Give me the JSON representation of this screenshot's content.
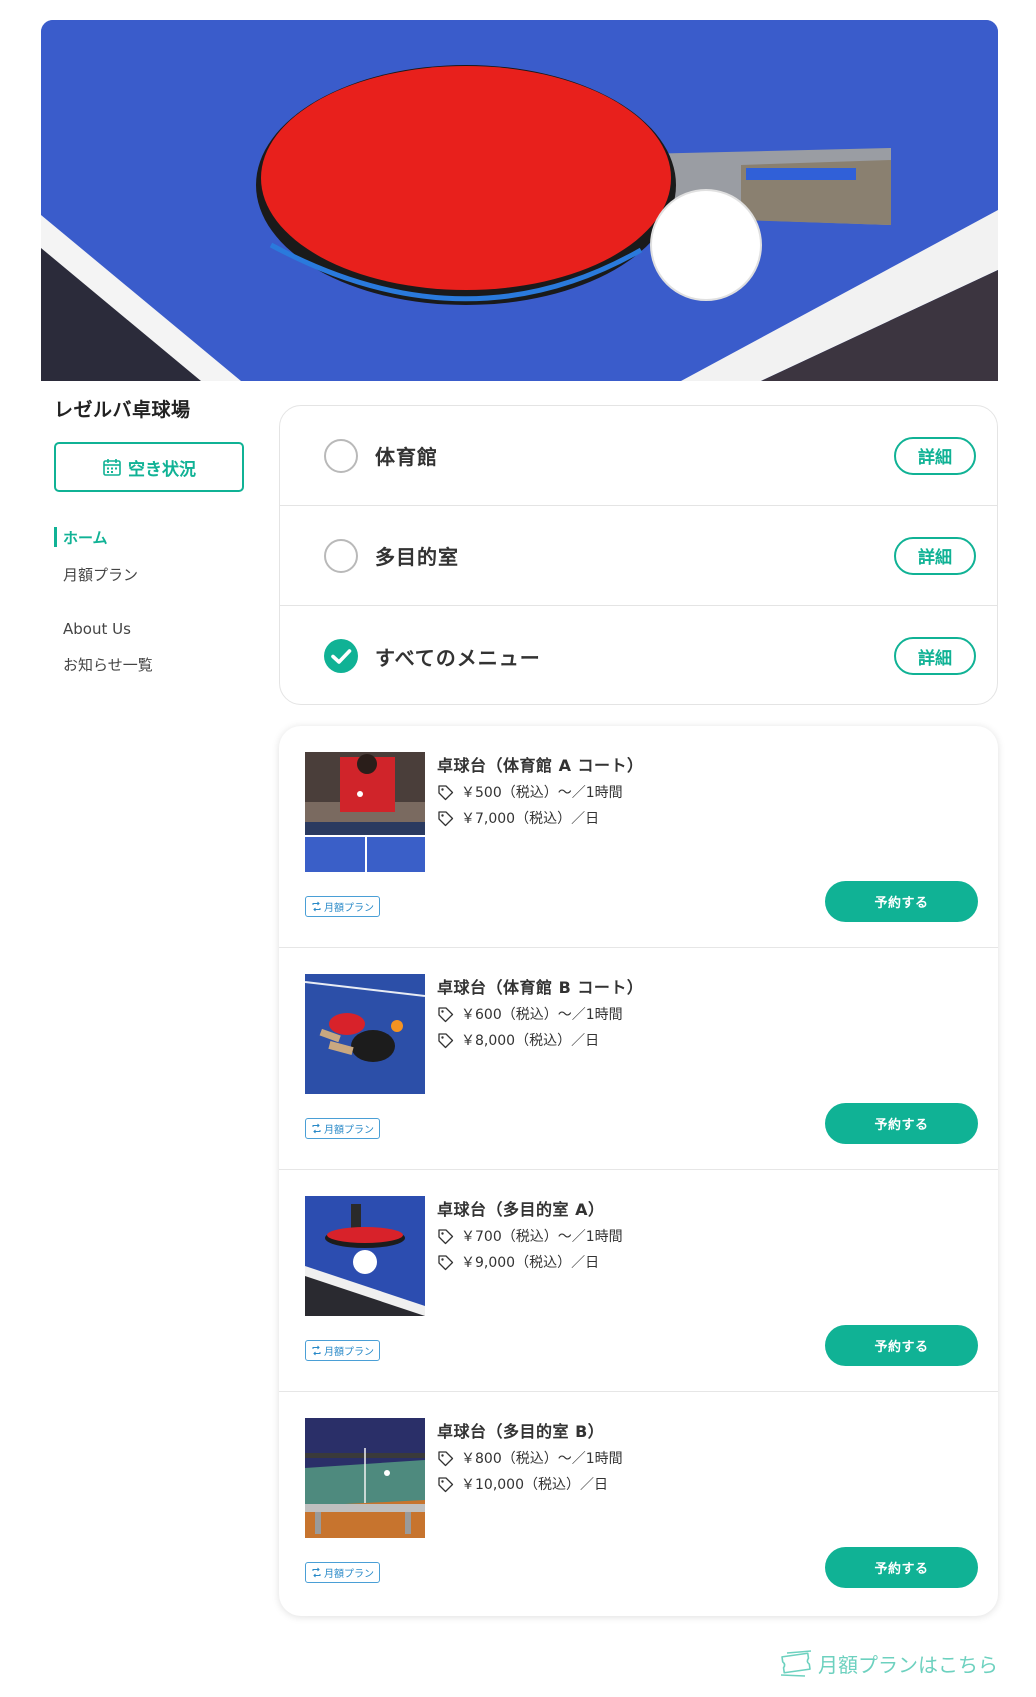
{
  "sidebar": {
    "shop_name": "レゼルバ卓球場",
    "availability_label": "空き状況",
    "nav": [
      {
        "label": "ホーム",
        "active": true
      },
      {
        "label": "月額プラン",
        "active": false
      },
      {
        "label": "About Us",
        "active": false
      },
      {
        "label": "お知らせ一覧",
        "active": false
      }
    ]
  },
  "categories": [
    {
      "label": "体育館",
      "checked": false,
      "detail_label": "詳細"
    },
    {
      "label": "多目的室",
      "checked": false,
      "detail_label": "詳細"
    },
    {
      "label": "すべてのメニュー",
      "checked": true,
      "detail_label": "詳細"
    }
  ],
  "items": [
    {
      "title": "卓球台（体育館 A コート）",
      "price_hour": "￥500（税込）〜／1時間",
      "price_day": "￥7,000（税込）／日",
      "badge": "月額プラン",
      "reserve_label": "予約する"
    },
    {
      "title": "卓球台（体育館 B コート）",
      "price_hour": "￥600（税込）〜／1時間",
      "price_day": "￥8,000（税込）／日",
      "badge": "月額プラン",
      "reserve_label": "予約する"
    },
    {
      "title": "卓球台（多目的室 A）",
      "price_hour": "￥700（税込）〜／1時間",
      "price_day": "￥9,000（税込）／日",
      "badge": "月額プラン",
      "reserve_label": "予約する"
    },
    {
      "title": "卓球台（多目的室 B）",
      "price_hour": "￥800（税込）〜／1時間",
      "price_day": "￥10,000（税込）／日",
      "badge": "月額プラン",
      "reserve_label": "予約する"
    }
  ],
  "footer": {
    "monthly_link": "月額プランはこちら"
  },
  "colors": {
    "accent": "#10b295",
    "badge": "#2a8ac8",
    "link": "#6dd1bf"
  },
  "icons": {
    "availability": "calendar-icon",
    "check": "check-icon",
    "price": "tag-icon",
    "badge": "repeat-icon",
    "monthly": "ticket-icon"
  }
}
